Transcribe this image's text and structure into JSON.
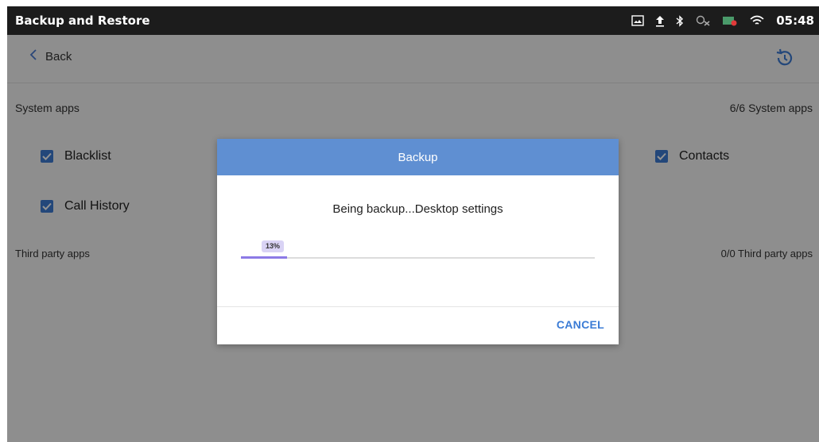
{
  "status_bar": {
    "title": "Backup and Restore",
    "time": "05:48",
    "icons": [
      "screenshot-icon",
      "upload-icon",
      "bluetooth-icon",
      "no-sync-icon",
      "battery-icon",
      "wifi-icon"
    ]
  },
  "navbar": {
    "back_label": "Back",
    "history_icon": "history-icon"
  },
  "system_apps": {
    "header": "System apps",
    "count": "6/6  System apps",
    "items": [
      {
        "label": "Blacklist",
        "checked": true
      },
      {
        "label": "Call History",
        "checked": true
      },
      {
        "label": "Contacts",
        "checked": true
      }
    ]
  },
  "third_party_apps": {
    "header": "Third party apps",
    "count": "0/0 Third party apps"
  },
  "dialog": {
    "title": "Backup",
    "message": "Being backup...Desktop settings",
    "progress_label": "13%",
    "progress_value": 0.13,
    "cancel_label": "CANCEL"
  },
  "colors": {
    "accent": "#3a7bd5",
    "dialog_header": "#5f8fd2",
    "progress": "#8c7ae6",
    "checkbox": "#3d7bd3"
  }
}
